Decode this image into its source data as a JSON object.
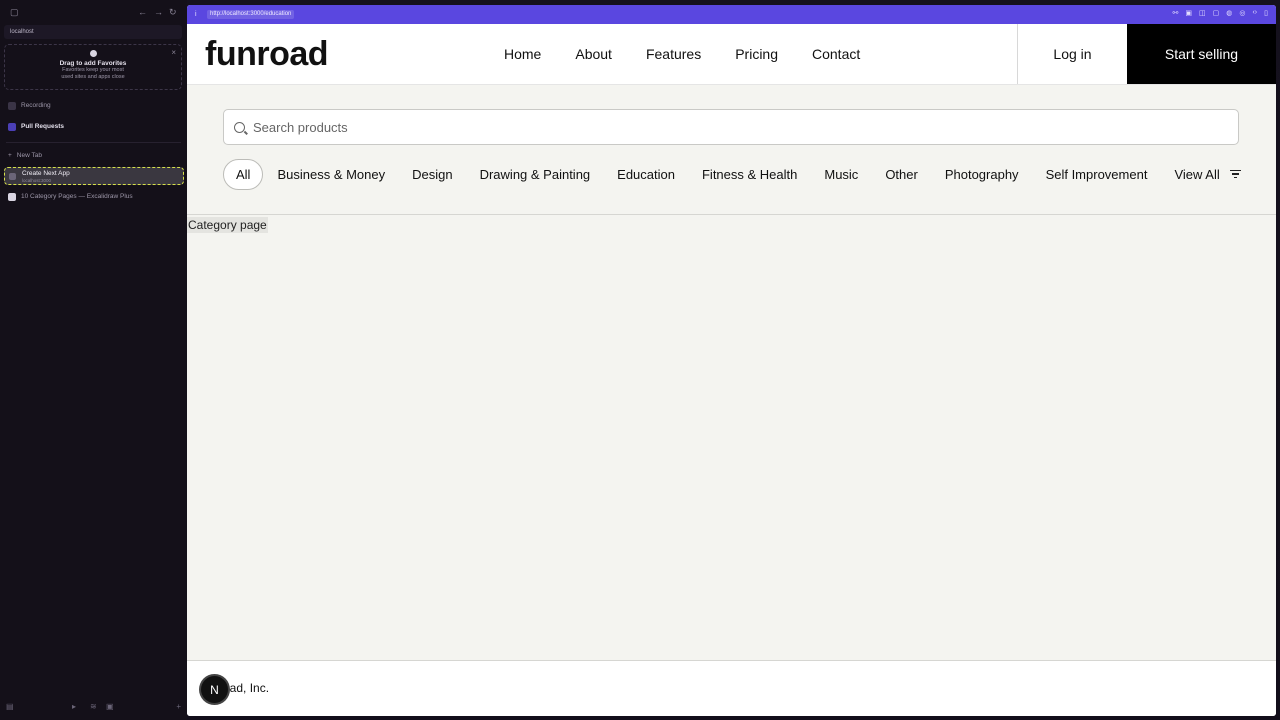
{
  "browser": {
    "sidebar": {
      "url_text": "localhost",
      "favorites": {
        "title": "Drag to add Favorites",
        "subtitle_line1": "Favorites keep your most",
        "subtitle_line2": "used sites and apps close"
      },
      "items": [
        {
          "label": "Recording"
        },
        {
          "label": "Pull Requests"
        },
        {
          "label": "New Tab"
        }
      ],
      "active_tab": {
        "label": "Create Next App",
        "sub": "localhost:3000"
      },
      "tabs": [
        {
          "label": "10 Category Pages — Excalidraw Plus"
        }
      ]
    },
    "address_bar": {
      "url": "http://localhost:3000/education"
    }
  },
  "site": {
    "logo": "funroad",
    "nav": [
      "Home",
      "About",
      "Features",
      "Pricing",
      "Contact"
    ],
    "login_label": "Log in",
    "sell_label": "Start selling",
    "search": {
      "placeholder": "Search products"
    },
    "categories": [
      "All",
      "Business & Money",
      "Design",
      "Drawing & Painting",
      "Education",
      "Fitness & Health",
      "Music",
      "Other",
      "Photography",
      "Self Improvement"
    ],
    "active_category": "All",
    "view_all_label": "View All",
    "content_label": "Category page",
    "footer_text": "oad, Inc.",
    "badge_letter": "N"
  }
}
